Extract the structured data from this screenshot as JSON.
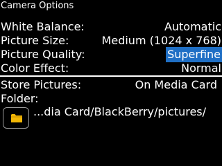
{
  "header": {
    "title": "Camera Options"
  },
  "settings": {
    "white_balance": {
      "label": "White Balance:",
      "value": "Automatic"
    },
    "picture_size": {
      "label": "Picture Size:",
      "value": "Medium (1024 x 768)"
    },
    "picture_quality": {
      "label": "Picture Quality:",
      "value": "Superfine",
      "selected": true
    },
    "color_effect": {
      "label": "Color Effect:",
      "value": "Normal"
    },
    "store_pictures": {
      "label": "Store Pictures:",
      "value": "On Media Card"
    },
    "folder": {
      "label": "Folder:",
      "path": "...dia Card/BlackBerry/pictures/",
      "icon": "folder-icon"
    }
  },
  "colors": {
    "background": "#000000",
    "text": "#ffffff",
    "selection": "#1f6fc5",
    "folder_icon": "#f2b705"
  }
}
